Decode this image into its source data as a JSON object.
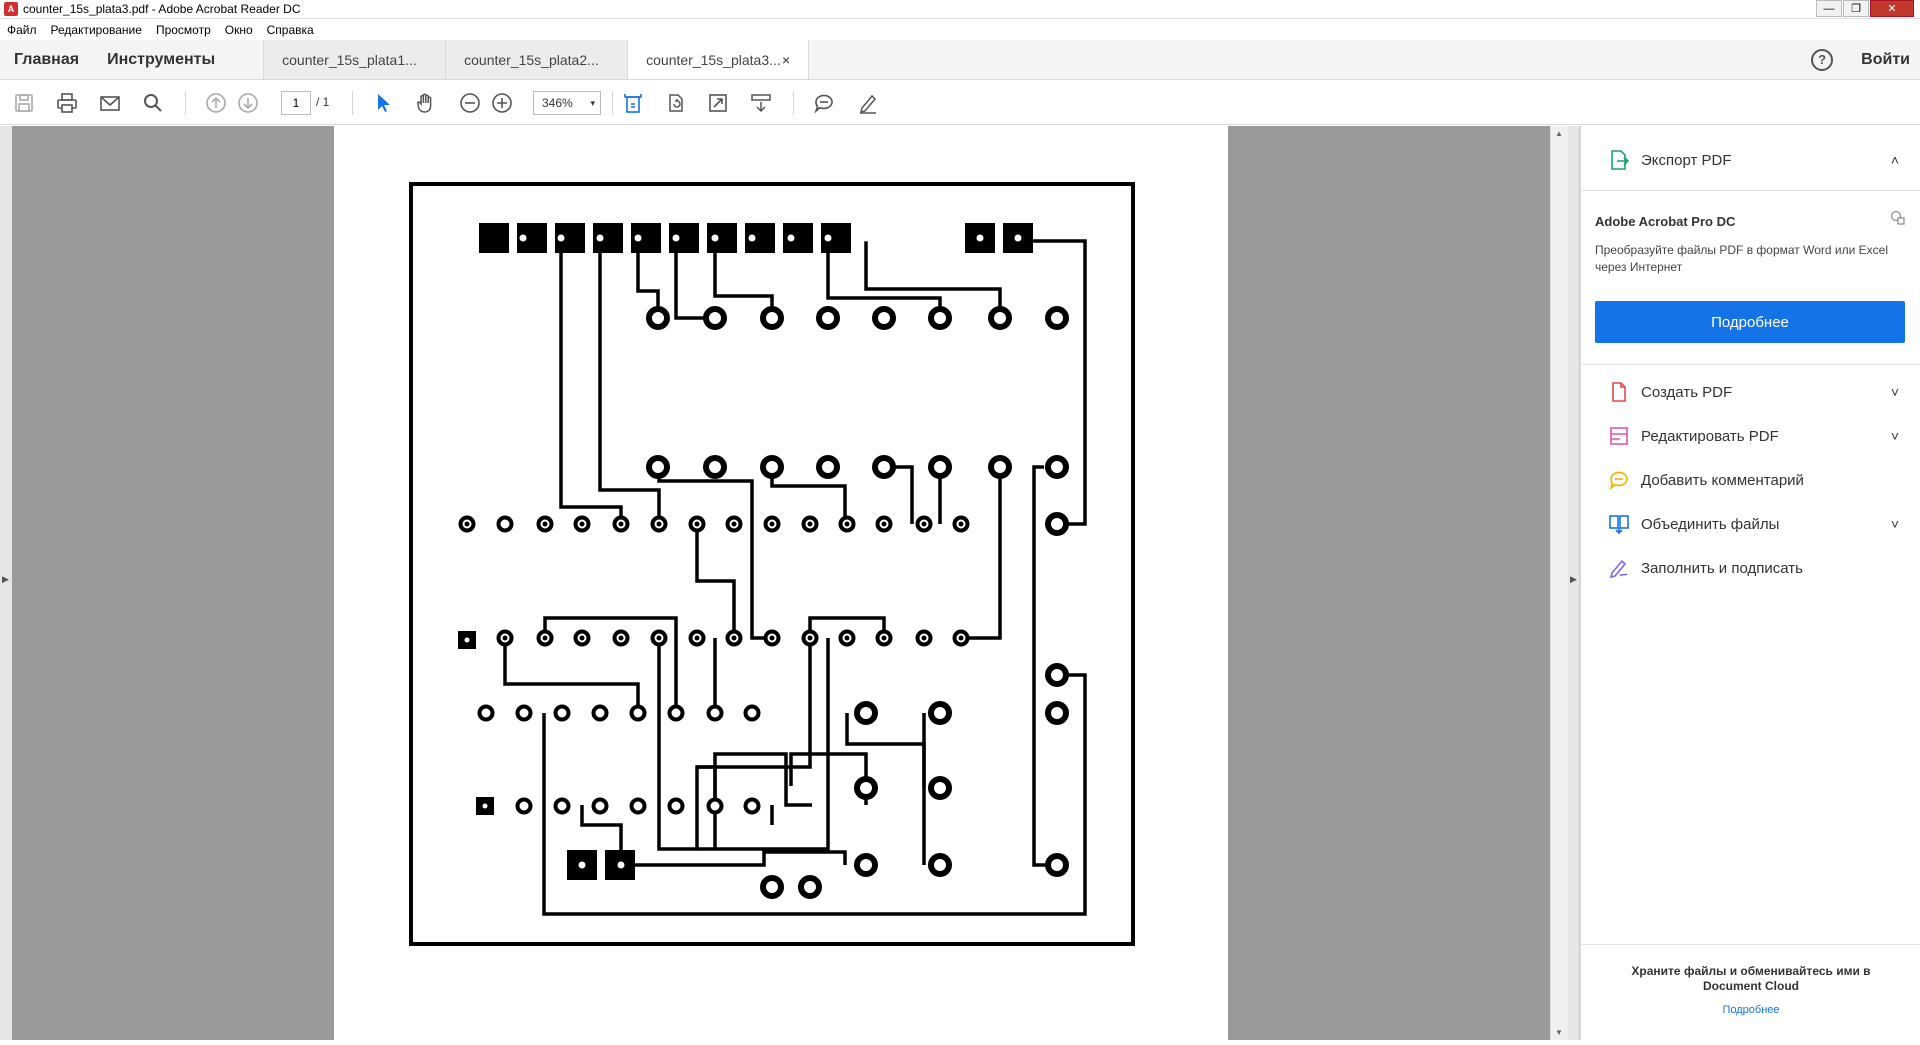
{
  "window": {
    "title": "counter_15s_plata3.pdf - Adobe Acrobat Reader DC",
    "controls": [
      "—",
      "❐",
      "✕"
    ]
  },
  "menu": [
    "Файл",
    "Редактирование",
    "Просмотр",
    "Окно",
    "Справка"
  ],
  "tabs": {
    "home": "Главная",
    "tools": "Инструменты",
    "docs": [
      "counter_15s_plata1...",
      "counter_15s_plata2...",
      "counter_15s_plata3..."
    ],
    "active_index": 2,
    "close": "×",
    "help": "?",
    "signin": "Войти"
  },
  "toolbar": {
    "page_current": "1",
    "page_total": "/ 1",
    "zoom": "346%",
    "zoom_arrow": "▾"
  },
  "right_panel": {
    "export": {
      "label": "Экспорт PDF",
      "chevron": "˄"
    },
    "promo": {
      "title": "Adobe Acrobat Pro DC",
      "text": "Преобразуйте файлы PDF в формат Word или Excel через Интернет",
      "button": "Подробнее"
    },
    "tools": [
      {
        "label": "Создать PDF",
        "icon": "create-pdf-icon",
        "color": "#e34850",
        "chevron": "˅"
      },
      {
        "label": "Редактировать PDF",
        "icon": "edit-pdf-icon",
        "color": "#e255a9",
        "chevron": "˅"
      },
      {
        "label": "Добавить комментарий",
        "icon": "comment-icon",
        "color": "#f0b400",
        "chevron": ""
      },
      {
        "label": "Объединить файлы",
        "icon": "combine-files-icon",
        "color": "#1473e6",
        "chevron": "˅"
      },
      {
        "label": "Заполнить и подписать",
        "icon": "fill-sign-icon",
        "color": "#7b68ee",
        "chevron": ""
      }
    ],
    "cloud": {
      "title": "Храните файлы и обменивайтесь ими в Document Cloud",
      "link": "Подробнее"
    }
  },
  "colors": {
    "accent": "#1473e6",
    "viewer_bg": "#999999",
    "trace": "#000000"
  }
}
